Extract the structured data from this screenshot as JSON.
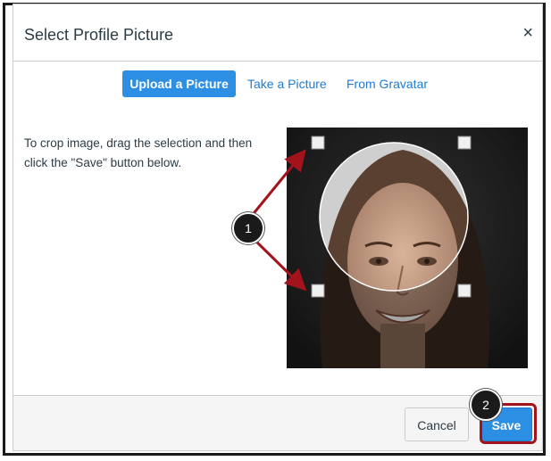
{
  "dialog": {
    "title": "Select Profile Picture",
    "close_label": "×"
  },
  "tabs": [
    {
      "label": "Upload a Picture",
      "active": true
    },
    {
      "label": "Take a Picture",
      "active": false
    },
    {
      "label": "From Gravatar",
      "active": false
    }
  ],
  "instructions": "To crop image, drag the selection and then click the \"Save\" button below.",
  "footer": {
    "cancel_label": "Cancel",
    "save_label": "Save"
  },
  "callouts": [
    "1",
    "2"
  ],
  "colors": {
    "accent": "#2c8fe3",
    "annotation": "#a3131c"
  }
}
